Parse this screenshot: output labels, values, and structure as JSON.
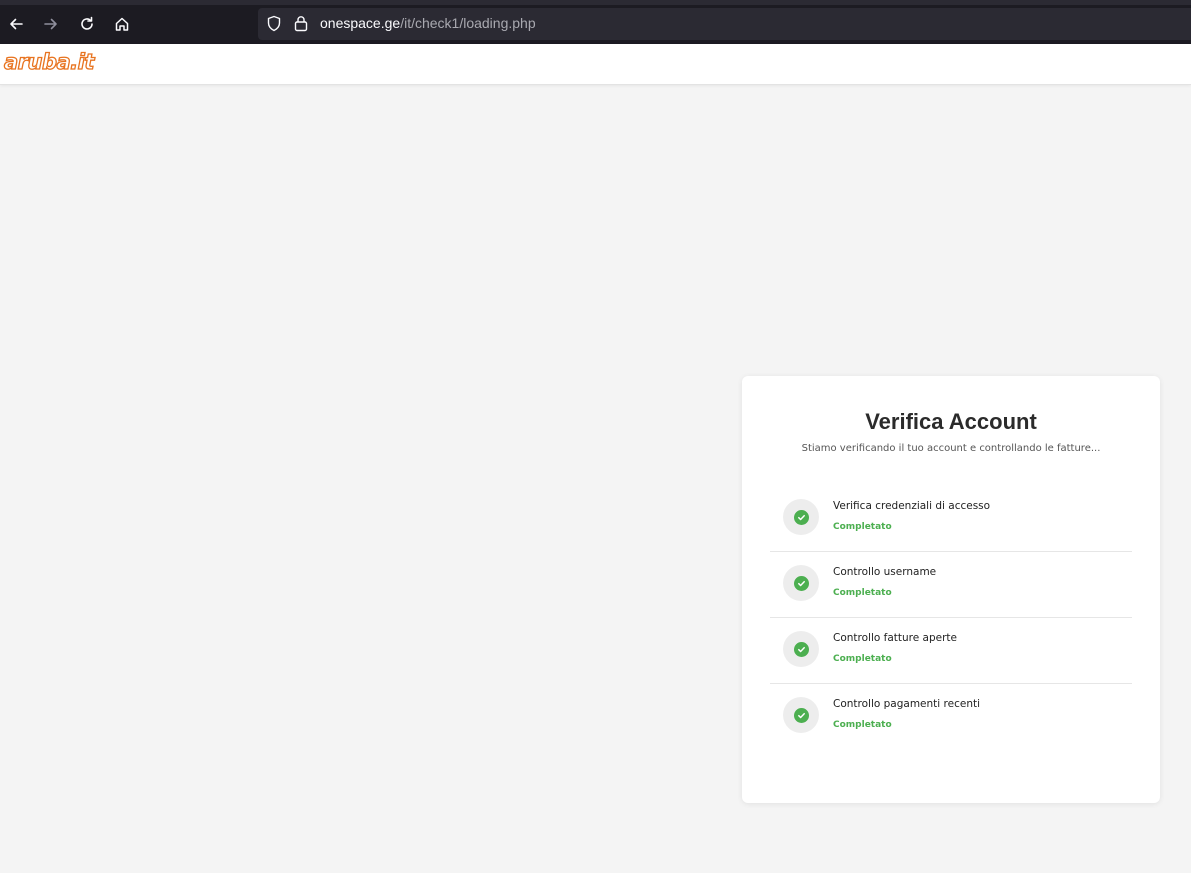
{
  "browser": {
    "url_host": "onespace.ge",
    "url_path": "/it/check1/loading.php",
    "icons": [
      "back-arrow-icon",
      "forward-arrow-icon",
      "reload-icon",
      "home-icon",
      "shield-icon",
      "lock-icon"
    ]
  },
  "header": {
    "logo_text": "aruba.it"
  },
  "card": {
    "title": "Verifica Account",
    "subtitle": "Stiamo verificando il tuo account e controllando le fatture...",
    "steps": [
      {
        "label": "Verifica credenziali di accesso",
        "status": "Completato"
      },
      {
        "label": "Controllo username",
        "status": "Completato"
      },
      {
        "label": "Controllo fatture aperte",
        "status": "Completato"
      },
      {
        "label": "Controllo pagamenti recenti",
        "status": "Completato"
      }
    ]
  },
  "colors": {
    "accent_green": "#4caf50",
    "logo_orange": "#e8731f",
    "browser_dark": "#1c1b22"
  }
}
